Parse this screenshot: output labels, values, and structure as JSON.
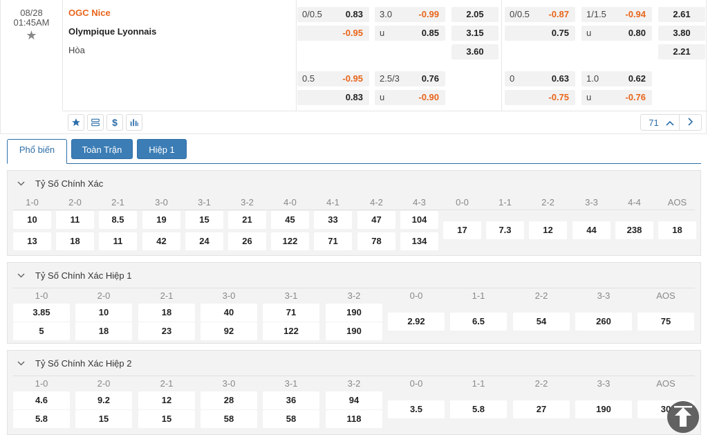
{
  "match": {
    "date": "08/28",
    "time": "01:45AM",
    "home": "OGC Nice",
    "away": "Olympique Lyonnais",
    "draw": "Hòa"
  },
  "odds": {
    "ft_hdp": {
      "line1": "0/0.5",
      "home1": "0.83",
      "away1": "-0.95",
      "line2": "0.5",
      "home2": "-0.95",
      "away2": "0.83"
    },
    "ft_ou": {
      "line1": "3.0",
      "over1": "-0.99",
      "u1_label": "u",
      "under1": "0.85",
      "line2": "2.5/3",
      "over2": "0.76",
      "u2_label": "u",
      "under2": "-0.90"
    },
    "ft_1x2": {
      "home": "2.05",
      "away": "3.15",
      "draw": "3.60"
    },
    "h1_hdp": {
      "line1": "0/0.5",
      "home1": "-0.87",
      "away1": "0.75",
      "line2": "0",
      "home2": "0.63",
      "away2": "-0.75"
    },
    "h1_ou": {
      "line1": "1/1.5",
      "over1": "-0.94",
      "u1_label": "u",
      "under1": "0.80",
      "line2": "1.0",
      "over2": "0.62",
      "u2_label": "u",
      "under2": "-0.76"
    },
    "h1_1x2": {
      "home": "2.61",
      "away": "3.80",
      "draw": "2.21"
    }
  },
  "toolbar": {
    "icons": [
      "star-icon",
      "list-icon",
      "dollar-icon",
      "chart-icon"
    ],
    "more_count": "71",
    "colors": {
      "accent": "#2d6ea8",
      "negative": "#e8651b"
    }
  },
  "tabs": [
    {
      "label": "Phổ biến",
      "active": true
    },
    {
      "label": "Toàn Trận",
      "active": false
    },
    {
      "label": "Hiệp 1",
      "active": false
    }
  ],
  "sections": [
    {
      "title": "Tỷ Số Chính Xác",
      "home_scores": [
        "1-0",
        "2-0",
        "2-1",
        "3-0",
        "3-1",
        "3-2",
        "4-0",
        "4-1",
        "4-2",
        "4-3"
      ],
      "home_odds": [
        "10",
        "11",
        "8.5",
        "19",
        "15",
        "21",
        "45",
        "33",
        "47",
        "104"
      ],
      "away_odds": [
        "13",
        "18",
        "11",
        "42",
        "24",
        "26",
        "122",
        "71",
        "78",
        "134"
      ],
      "draw_scores": [
        "0-0",
        "1-1",
        "2-2",
        "3-3",
        "4-4",
        "AOS"
      ],
      "draw_odds": [
        "17",
        "7.3",
        "12",
        "44",
        "238",
        "18"
      ]
    },
    {
      "title": "Tỷ Số Chính Xác Hiệp 1",
      "home_scores": [
        "1-0",
        "2-0",
        "2-1",
        "3-0",
        "3-1",
        "3-2"
      ],
      "home_odds": [
        "3.85",
        "10",
        "18",
        "40",
        "71",
        "190"
      ],
      "away_odds": [
        "5",
        "18",
        "23",
        "92",
        "122",
        "190"
      ],
      "draw_scores": [
        "0-0",
        "1-1",
        "2-2",
        "3-3",
        "AOS"
      ],
      "draw_odds": [
        "2.92",
        "6.5",
        "54",
        "260",
        "75"
      ]
    },
    {
      "title": "Tỷ Số Chính Xác Hiệp 2",
      "home_scores": [
        "1-0",
        "2-0",
        "2-1",
        "3-0",
        "3-1",
        "3-2"
      ],
      "home_odds": [
        "4.6",
        "9.2",
        "12",
        "28",
        "36",
        "94"
      ],
      "away_odds": [
        "5.8",
        "15",
        "15",
        "58",
        "58",
        "118"
      ],
      "draw_scores": [
        "0-0",
        "1-1",
        "2-2",
        "3-3",
        "AOS"
      ],
      "draw_odds": [
        "3.5",
        "5.8",
        "27",
        "190",
        "30"
      ]
    }
  ]
}
